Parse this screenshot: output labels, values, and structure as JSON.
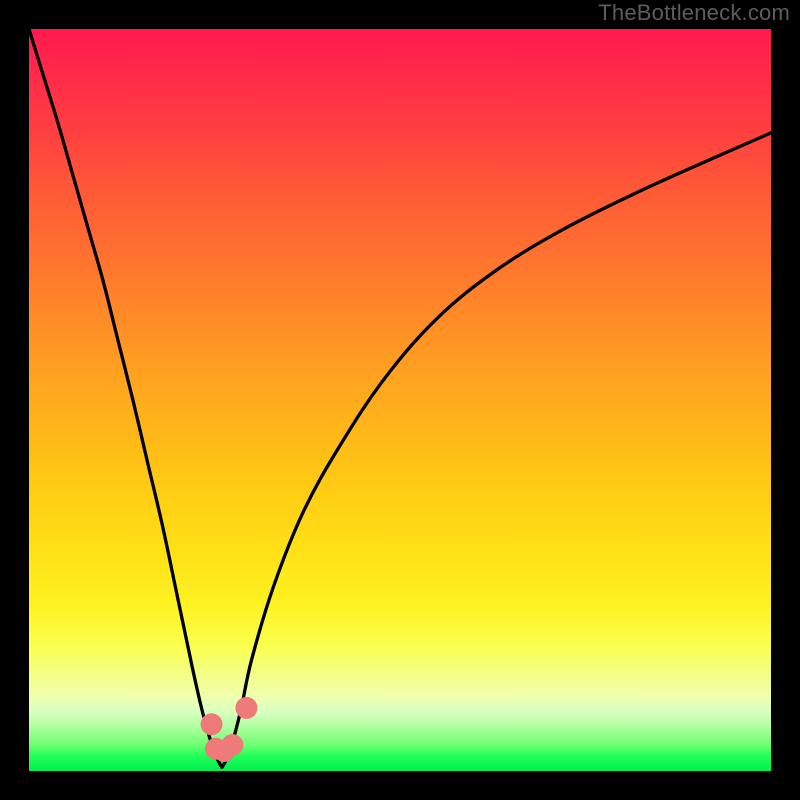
{
  "attribution": {
    "text": "TheBottleneck.com"
  },
  "colors": {
    "frame": "#000000",
    "curve": "#000000",
    "marker": "#ee7a7a",
    "gradient_top": "#ff1a4d",
    "gradient_bottom": "#00f050",
    "attribution_text": "#5d5d5d"
  },
  "chart_data": {
    "type": "line",
    "title": "",
    "xlabel": "",
    "ylabel": "",
    "xlim": [
      0,
      100
    ],
    "ylim": [
      0,
      100
    ],
    "grid": false,
    "legend": false,
    "series": [
      {
        "name": "bottleneck_curve_left",
        "x": [
          0,
          2,
          4,
          6,
          8,
          10,
          12,
          14,
          16,
          18,
          20,
          22,
          23.5,
          25,
          26
        ],
        "values": [
          100,
          93.5,
          87,
          80,
          73,
          66,
          58,
          50,
          41.5,
          33,
          23.5,
          14,
          7.5,
          2.5,
          0.5
        ]
      },
      {
        "name": "bottleneck_curve_right",
        "x": [
          26,
          27,
          28.5,
          30,
          33,
          37,
          42,
          48,
          55,
          63,
          72,
          82,
          92,
          100
        ],
        "values": [
          0.5,
          2.5,
          8,
          15,
          25,
          35,
          44,
          53,
          61,
          67.5,
          73,
          78,
          82.5,
          86
        ]
      }
    ],
    "markers": [
      {
        "name": "target-marker-1",
        "x": 24.6,
        "y": 6.3
      },
      {
        "name": "target-marker-2",
        "x": 25.2,
        "y": 3.0
      },
      {
        "name": "target-marker-3",
        "x": 26.3,
        "y": 2.7
      },
      {
        "name": "target-marker-4",
        "x": 27.4,
        "y": 3.5
      },
      {
        "name": "target-marker-5",
        "x": 29.3,
        "y": 8.5
      }
    ],
    "min_point": {
      "x": 26,
      "y": 0.5
    },
    "annotations": []
  }
}
